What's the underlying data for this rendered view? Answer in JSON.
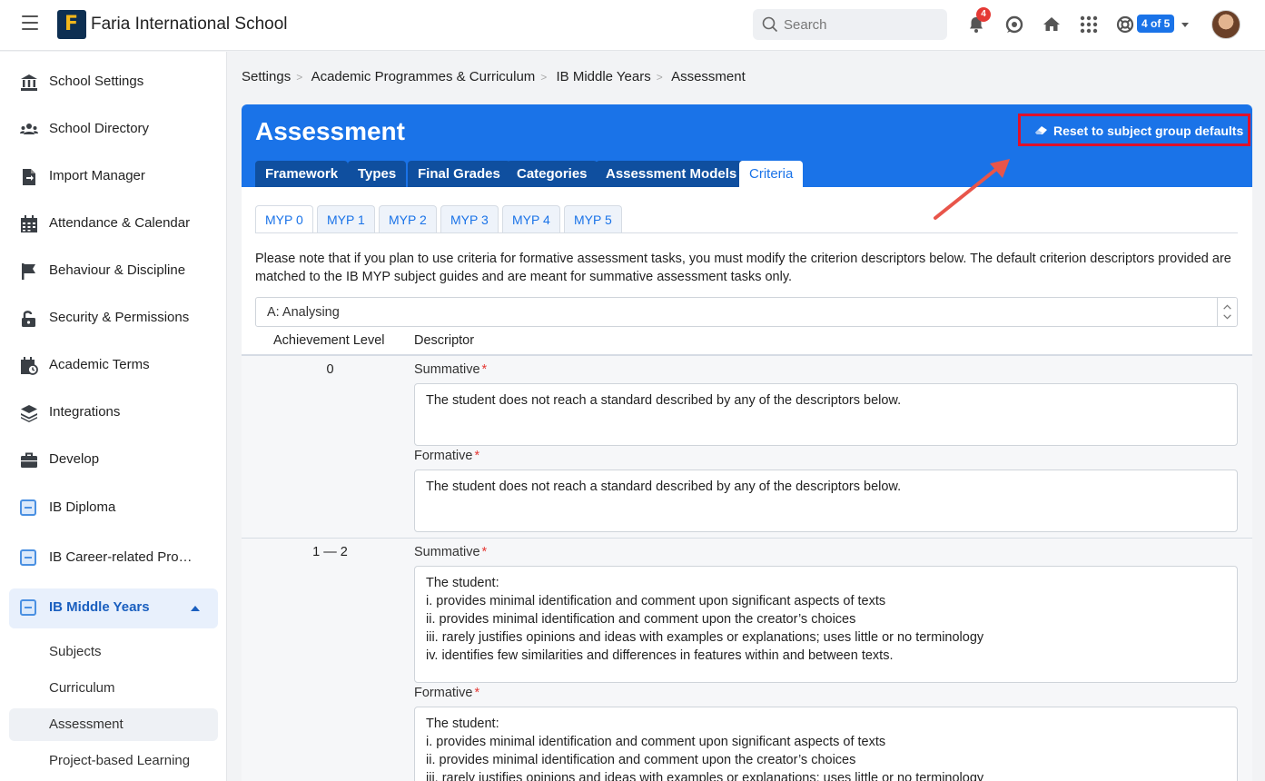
{
  "app": {
    "school_name": "Faria International School",
    "search_placeholder": "Search",
    "notification_count": "4",
    "page_counter": "4 of 5"
  },
  "sidebar": {
    "items": [
      {
        "label": "School Settings",
        "icon": "bank-icon"
      },
      {
        "label": "School Directory",
        "icon": "users-icon"
      },
      {
        "label": "Import Manager",
        "icon": "file-import-icon"
      },
      {
        "label": "Attendance & Calendar",
        "icon": "calendar-grid-icon"
      },
      {
        "label": "Behaviour & Discipline",
        "icon": "flag-icon"
      },
      {
        "label": "Security & Permissions",
        "icon": "lock-icon"
      },
      {
        "label": "Academic Terms",
        "icon": "calendar-clock-icon"
      },
      {
        "label": "Integrations",
        "icon": "layers-icon"
      },
      {
        "label": "Develop",
        "icon": "briefcase-icon"
      },
      {
        "label": "IB Diploma",
        "icon": "ib-dp-icon"
      },
      {
        "label": "IB Career-related Pro…",
        "icon": "ib-cp-icon"
      },
      {
        "label": "IB Middle Years",
        "icon": "ib-myp-icon"
      }
    ],
    "sub_items": [
      {
        "label": "Subjects"
      },
      {
        "label": "Curriculum"
      },
      {
        "label": "Assessment"
      },
      {
        "label": "Project-based Learning"
      }
    ]
  },
  "breadcrumb": [
    "Settings",
    "Academic Programmes & Curriculum",
    "IB Middle Years",
    "Assessment"
  ],
  "panel": {
    "title": "Assessment",
    "reset_label": "Reset to subject group defaults",
    "tabs": [
      "Framework",
      "Types",
      "Final Grades",
      "Categories",
      "Assessment Models",
      "Criteria"
    ],
    "active_tab": "Criteria",
    "year_tabs": [
      "MYP 0",
      "MYP 1",
      "MYP 2",
      "MYP 3",
      "MYP 4",
      "MYP 5"
    ],
    "active_year": "MYP 0",
    "note": "Please note that if you plan to use criteria for formative assessment tasks, you must modify the criterion descriptors below. The default criterion descriptors provided are matched to the IB MYP subject guides and are meant for summative assessment tasks only.",
    "criterion_selected": "A: Analysing",
    "table_headers": {
      "level": "Achievement Level",
      "descriptor": "Descriptor"
    },
    "summative_label": "Summative",
    "formative_label": "Formative",
    "required_mark": "*",
    "rows": [
      {
        "level": "0",
        "summative": "The student does not reach a standard described by any of the descriptors below.",
        "formative": "The student does not reach a standard described by any of the descriptors below."
      },
      {
        "level": "1 — 2",
        "summative": "The student:\ni. provides minimal identification and comment upon significant aspects of texts\nii. provides minimal identification and comment upon the creator’s choices\niii. rarely justifies opinions and ideas with examples or explanations; uses little or no terminology\niv. identifies few similarities and differences in features within and between texts.",
        "formative": "The student:\ni. provides minimal identification and comment upon significant aspects of texts\nii. provides minimal identification and comment upon the creator’s choices\niii. rarely justifies opinions and ideas with examples or explanations; uses little or no terminology"
      }
    ]
  },
  "colors": {
    "brand_blue": "#1a73e8",
    "tab_dark": "#0f4f9f",
    "highlight_red": "#e0102a",
    "arrow": "#e8554a"
  }
}
